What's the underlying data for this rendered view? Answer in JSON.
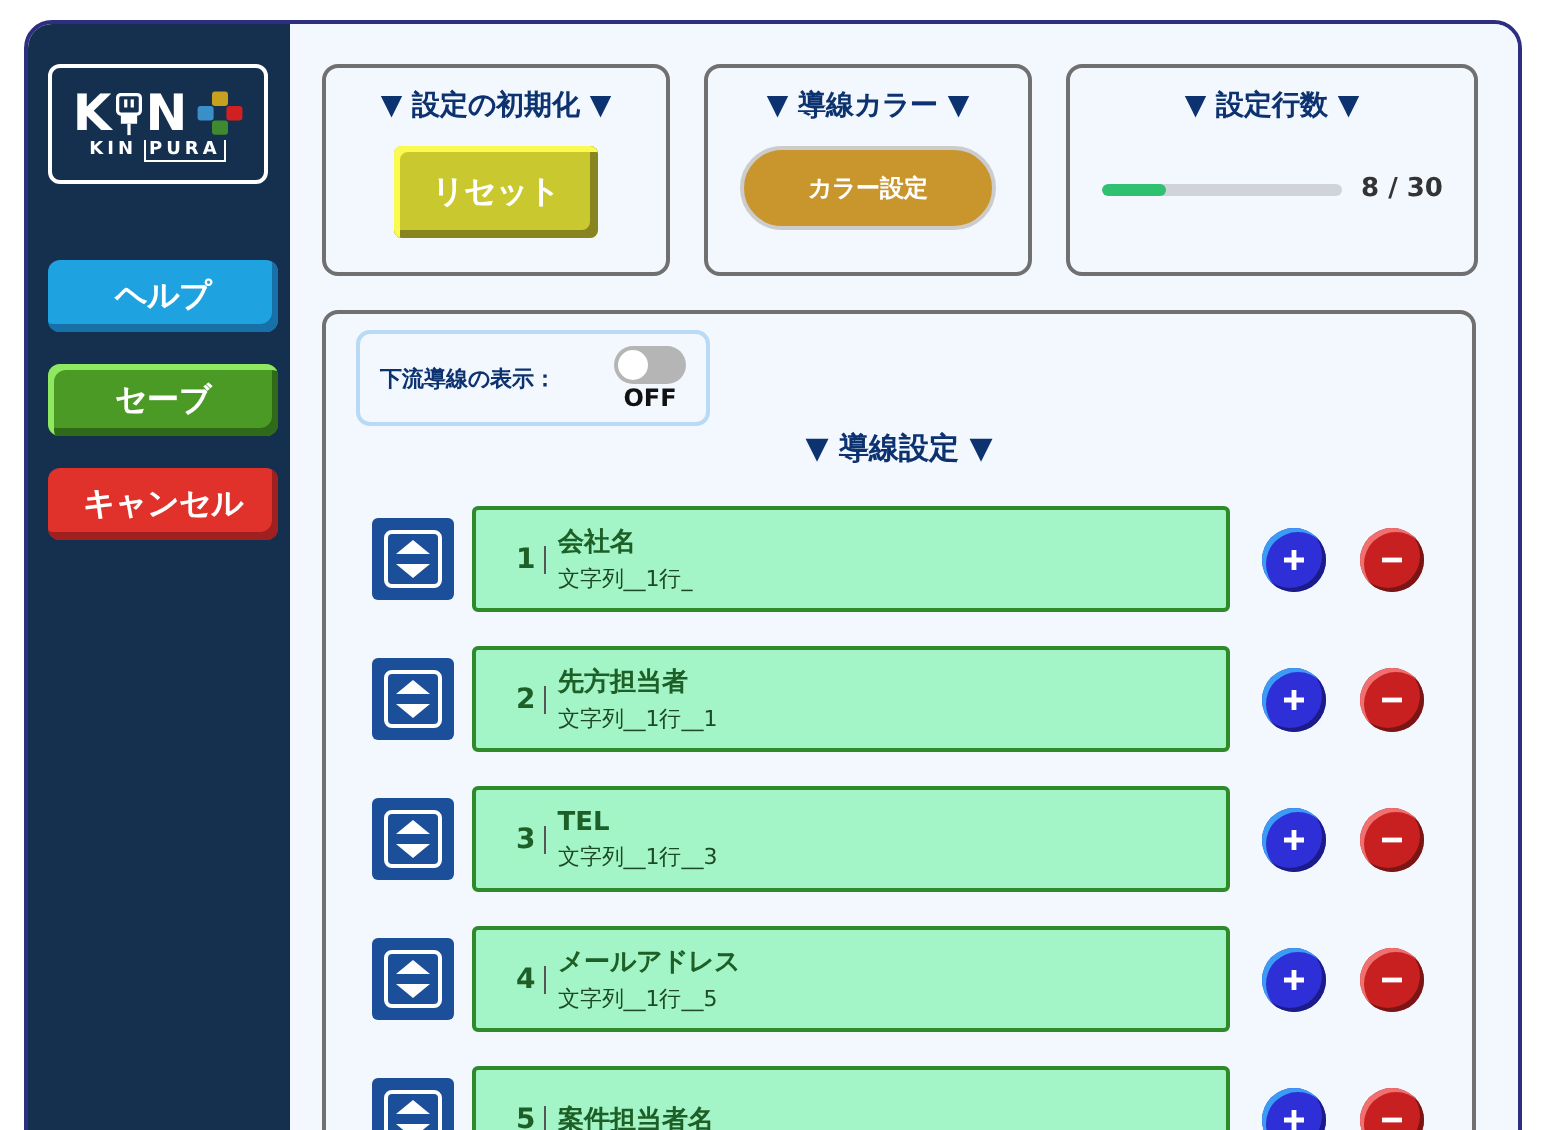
{
  "logo": {
    "letter_left": "K",
    "letter_right": "N",
    "sub_left": "KIN",
    "sub_right": "PURA"
  },
  "sidebar": {
    "buttons": [
      {
        "label": "ヘルプ",
        "kind": "help"
      },
      {
        "label": "セーブ",
        "kind": "save"
      },
      {
        "label": "キャンセル",
        "kind": "cancel"
      }
    ]
  },
  "reset_card": {
    "title": "▼ 設定の初期化 ▼",
    "button": "リセット"
  },
  "color_card": {
    "title": "▼ 導線カラー ▼",
    "button": "カラー設定"
  },
  "count_card": {
    "title": "▼ 設定行数 ▼",
    "level": 0.27,
    "reading": "8 / 30"
  },
  "downstream_toggle": {
    "label": "下流導線の表示：",
    "on": false,
    "state_text": "OFF"
  },
  "section_title": "▼ 導線設定 ▼",
  "rows": [
    {
      "number": "1",
      "name": "会社名",
      "detail": "文字列__1行_"
    },
    {
      "number": "2",
      "name": "先方担当者",
      "detail": "文字列__1行__1"
    },
    {
      "number": "3",
      "name": "TEL",
      "detail": "文字列__1行__3"
    },
    {
      "number": "4",
      "name": "メールアドレス",
      "detail": "文字列__1行__5"
    },
    {
      "number": "5",
      "name": "案件担当者名"
    }
  ]
}
